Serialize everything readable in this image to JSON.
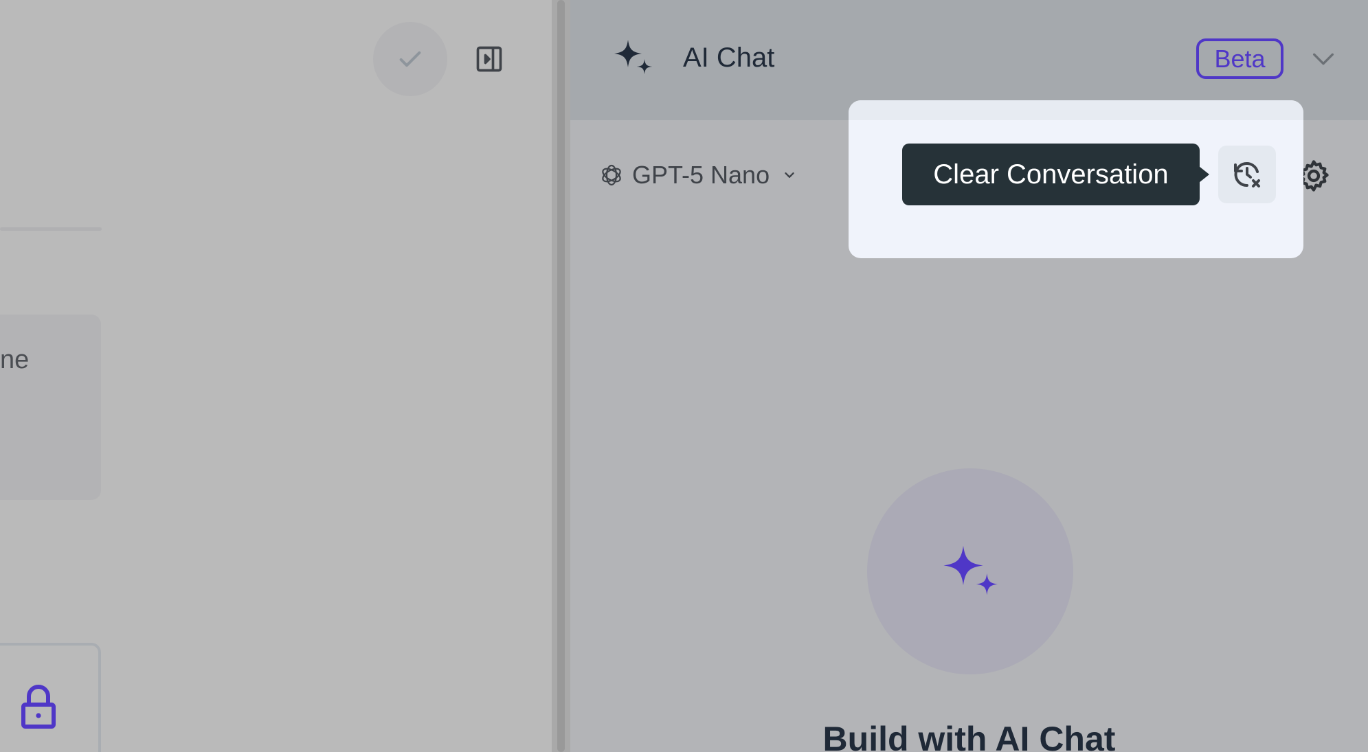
{
  "left_panel": {
    "card_text": "ne"
  },
  "chat": {
    "title": "AI Chat",
    "badge": "Beta",
    "model": "GPT-5 Nano",
    "tooltip": "Clear Conversation",
    "hero_title": "Build with AI Chat"
  },
  "icons": {
    "check": "check-icon",
    "panel_toggle": "panel-right-icon",
    "lock": "lock-icon",
    "sparkle": "sparkles-icon",
    "chevron": "chevron-down-icon",
    "model": "openai-icon",
    "clear": "history-clear-icon",
    "settings": "gear-icon"
  },
  "colors": {
    "accent": "#4f37c7",
    "tooltip_bg": "#263238",
    "title_text": "#1f2937"
  }
}
